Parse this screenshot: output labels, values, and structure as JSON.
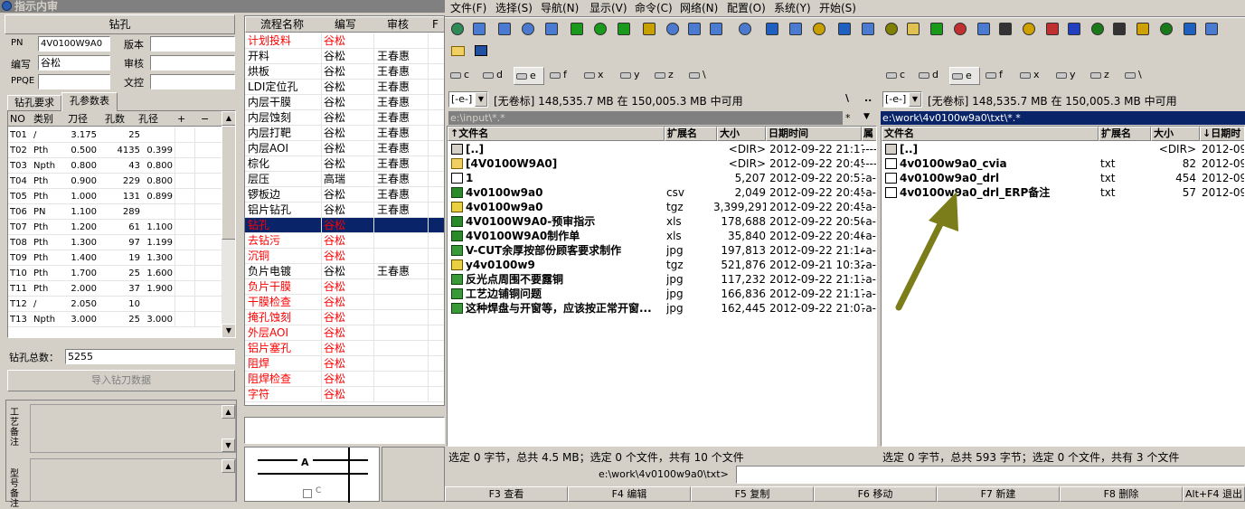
{
  "title": "指示内审",
  "left": {
    "drill_button": "钻孔",
    "pn_label": "PN",
    "pn_value": "4V0100W9A0",
    "version_label": "版本",
    "version_value": "",
    "author_label": "编写",
    "author_value": "谷松",
    "review_label": "审核",
    "review_value": "",
    "ppqe_label": "PPQE",
    "ppqe_value": "",
    "control_label": "文控",
    "control_value": "",
    "tabs": [
      "钻孔要求",
      "孔参数表"
    ],
    "headers": [
      "NO",
      "类别",
      "刀径",
      "孔数",
      "孔径",
      "+",
      "−"
    ],
    "rows": [
      [
        "T01",
        "/",
        "3.175",
        "25",
        ""
      ],
      [
        "T02",
        "Pth",
        "0.500",
        "4135",
        "0.399"
      ],
      [
        "T03",
        "Npth",
        "0.800",
        "43",
        "0.800"
      ],
      [
        "T04",
        "Pth",
        "0.900",
        "229",
        "0.800"
      ],
      [
        "T05",
        "Pth",
        "1.000",
        "131",
        "0.899"
      ],
      [
        "T06",
        "PN",
        "1.100",
        "289",
        ""
      ],
      [
        "T07",
        "Pth",
        "1.200",
        "61",
        "1.100"
      ],
      [
        "T08",
        "Pth",
        "1.300",
        "97",
        "1.199"
      ],
      [
        "T09",
        "Pth",
        "1.400",
        "19",
        "1.300"
      ],
      [
        "T10",
        "Pth",
        "1.700",
        "25",
        "1.600"
      ],
      [
        "T11",
        "Pth",
        "2.000",
        "37",
        "1.900"
      ],
      [
        "T12",
        "/",
        "2.050",
        "10",
        ""
      ],
      [
        "T13",
        "Npth",
        "3.000",
        "25",
        "3.000"
      ]
    ],
    "total_label": "钻孔总数：",
    "total_value": "5255",
    "import_button": "导入钻刀数据",
    "notes_label": "工艺备注",
    "model_label": "型号备注"
  },
  "process": {
    "headers": [
      "流程名称",
      "编写",
      "审核",
      "F"
    ],
    "rows": [
      {
        "name": "计划投料",
        "author": "谷松",
        "reviewer": "",
        "red": true
      },
      {
        "name": "开料",
        "author": "谷松",
        "reviewer": "王春惠",
        "red": false
      },
      {
        "name": "烘板",
        "author": "谷松",
        "reviewer": "王春惠",
        "red": false
      },
      {
        "name": "LDI定位孔",
        "author": "谷松",
        "reviewer": "王春惠",
        "red": false
      },
      {
        "name": "内层干膜",
        "author": "谷松",
        "reviewer": "王春惠",
        "red": false
      },
      {
        "name": "内层蚀刻",
        "author": "谷松",
        "reviewer": "王春惠",
        "red": false
      },
      {
        "name": "内层打靶",
        "author": "谷松",
        "reviewer": "王春惠",
        "red": false
      },
      {
        "name": "内层AOI",
        "author": "谷松",
        "reviewer": "王春惠",
        "red": false
      },
      {
        "name": "棕化",
        "author": "谷松",
        "reviewer": "王春惠",
        "red": false
      },
      {
        "name": "层压",
        "author": "高瑞",
        "reviewer": "王春惠",
        "red": false
      },
      {
        "name": "锣板边",
        "author": "谷松",
        "reviewer": "王春惠",
        "red": false
      },
      {
        "name": "铝片钻孔",
        "author": "谷松",
        "reviewer": "王春惠",
        "red": false
      },
      {
        "name": "钻孔",
        "author": "谷松",
        "reviewer": "",
        "red": true,
        "selected": true
      },
      {
        "name": "去钻污",
        "author": "谷松",
        "reviewer": "",
        "red": true
      },
      {
        "name": "沉铜",
        "author": "谷松",
        "reviewer": "",
        "red": true
      },
      {
        "name": "负片电镀",
        "author": "谷松",
        "reviewer": "王春惠",
        "red": false
      },
      {
        "name": "负片干膜",
        "author": "谷松",
        "reviewer": "",
        "red": true
      },
      {
        "name": "干膜检查",
        "author": "谷松",
        "reviewer": "",
        "red": true
      },
      {
        "name": "掩孔蚀刻",
        "author": "谷松",
        "reviewer": "",
        "red": true
      },
      {
        "name": "外层AOI",
        "author": "谷松",
        "reviewer": "",
        "red": true
      },
      {
        "name": "铝片塞孔",
        "author": "谷松",
        "reviewer": "",
        "red": true
      },
      {
        "name": "阻焊",
        "author": "谷松",
        "reviewer": "",
        "red": true
      },
      {
        "name": "阻焊检查",
        "author": "谷松",
        "reviewer": "",
        "red": true
      },
      {
        "name": "字符",
        "author": "谷松",
        "reviewer": "",
        "red": true
      }
    ],
    "drawing_label": "A",
    "drawing_check": "C"
  },
  "tc": {
    "menu": [
      "文件(F)",
      "选择(S)",
      "导航(N)",
      "显示(V)",
      "命令(C)",
      "网络(N)",
      "配置(O)",
      "系统(Y)",
      "开始(S)"
    ],
    "drives": [
      "c",
      "d",
      "e",
      "f",
      "x",
      "y",
      "z",
      "\\"
    ],
    "left_drive_select": "[-e-]",
    "right_drive_select": "[-e-]",
    "left_free": "[无卷标]  148,535.7 MB 在 150,005.3 MB 中可用",
    "right_free": "[无卷标]  148,535.7 MB 在 150,005.3 MB 中可用",
    "left_root_btn": "\\",
    "left_up_btn": "..",
    "right_root_btn": "\\",
    "right_up_btn": "..",
    "left_path": "e:\\input\\*.*",
    "right_path": "e:\\work\\4v0100w9a0\\txt\\*.*",
    "left_path_star": "*",
    "left_path_arrow": "▼",
    "headers": [
      "↑文件名",
      "扩展名",
      "大小",
      "日期时间",
      "属性"
    ],
    "right_headers": [
      "文件名",
      "扩展名",
      "大小",
      "↓日期时间"
    ],
    "left_files": [
      {
        "name": "[..]",
        "ext": "",
        "size": "<DIR>",
        "date": "2012-09-22 21:17",
        "attr": "----",
        "icon": "up"
      },
      {
        "name": "[4V0100W9A0]",
        "ext": "",
        "size": "<DIR>",
        "date": "2012-09-22 20:45",
        "attr": "----",
        "icon": "folder"
      },
      {
        "name": "1",
        "ext": "",
        "size": "5,207",
        "date": "2012-09-22 20:51",
        "attr": "-a-",
        "icon": "file"
      },
      {
        "name": "4v0100w9a0",
        "ext": "csv",
        "size": "2,049",
        "date": "2012-09-22 20:45",
        "attr": "-a-",
        "icon": "excel"
      },
      {
        "name": "4v0100w9a0",
        "ext": "tgz",
        "size": "3,399,291",
        "date": "2012-09-22 20:45",
        "attr": "-a-",
        "icon": "zip"
      },
      {
        "name": "4V0100W9A0-预审指示",
        "ext": "xls",
        "size": "178,688",
        "date": "2012-09-22 20:50",
        "attr": "-a-",
        "icon": "excel"
      },
      {
        "name": "4V0100W9A0制作单",
        "ext": "xls",
        "size": "35,840",
        "date": "2012-09-22 20:46",
        "attr": "-a-",
        "icon": "excel"
      },
      {
        "name": "V-CUT余厚按部份顾客要求制作",
        "ext": "jpg",
        "size": "197,813",
        "date": "2012-09-22 21:14",
        "attr": "-a-",
        "icon": "image"
      },
      {
        "name": "y4v0100w9",
        "ext": "tgz",
        "size": "521,876",
        "date": "2012-09-21 10:32",
        "attr": "-a-",
        "icon": "zip"
      },
      {
        "name": "反光点周围不要露铜",
        "ext": "jpg",
        "size": "117,232",
        "date": "2012-09-22 21:13",
        "attr": "-a-",
        "icon": "image"
      },
      {
        "name": "工艺边铺铜问题",
        "ext": "jpg",
        "size": "166,836",
        "date": "2012-09-22 21:17",
        "attr": "-a-",
        "icon": "image"
      },
      {
        "name": "这种焊盘与开窗等，应该按正常开窗...",
        "ext": "jpg",
        "size": "162,445",
        "date": "2012-09-22 21:07",
        "attr": "-a-",
        "icon": "image"
      }
    ],
    "right_files": [
      {
        "name": "[..]",
        "ext": "",
        "size": "<DIR>",
        "date": "2012-09-",
        "icon": "up"
      },
      {
        "name": "4v0100w9a0_cvia",
        "ext": "txt",
        "size": "82",
        "date": "2012-09-",
        "icon": "txt"
      },
      {
        "name": "4v0100w9a0_drl",
        "ext": "txt",
        "size": "454",
        "date": "2012-09-",
        "icon": "txt"
      },
      {
        "name": "4v0100w9a0_drl_ERP备注",
        "ext": "txt",
        "size": "57",
        "date": "2012-09-",
        "icon": "txt"
      }
    ],
    "left_status": "选定 0 字节，总共 4.5 MB；选定 0 个文件，共有 10 个文件",
    "right_status": "选定 0 字节，总共 593 字节；选定 0 个文件，共有 3 个文件",
    "cmd_prompt": "e:\\work\\4v0100w9a0\\txt>",
    "cmd_value": "",
    "fkeys": [
      "F3 查看",
      "F4 编辑",
      "F5 复制",
      "F6 移动",
      "F7 新建",
      "F8 删除",
      "Alt+F4 退出"
    ]
  },
  "colors": {
    "red": "#ff0000",
    "select": "#0a246a",
    "arrow": "#7b7d1a",
    "title_bar": "#808080"
  }
}
